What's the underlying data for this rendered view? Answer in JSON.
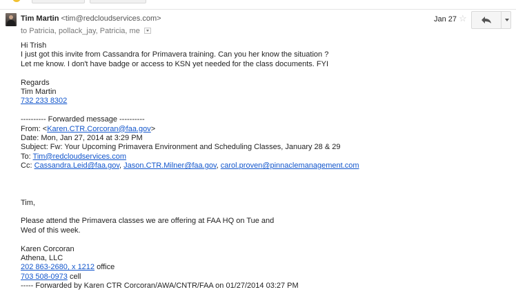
{
  "header": {
    "sender_name": "Tim Martin",
    "sender_email": "<tim@redcloudservices.com>",
    "recipients": "to Patricia, pollack_jay, Patricia, me",
    "date": "Jan 27"
  },
  "icons": {
    "avatar": "avatar-photo",
    "star": "star-icon",
    "reply": "reply-icon",
    "more": "chevron-down-icon",
    "recipients_details": "dropdown-icon"
  },
  "colors": {
    "link": "#1155cc",
    "text": "#222222",
    "muted": "#777777"
  },
  "message": {
    "greeting": "Hi Trish",
    "line1": "I just got this invite from Cassandra for Primavera training. Can you her know the situation ?",
    "line2": "Let me know. I don't have badge or access to KSN yet needed for the class documents. FYI",
    "regards": "Regards",
    "sig_name": "Tim Martin",
    "sig_phone": "732 233 8302"
  },
  "forwarded": {
    "divider": "---------- Forwarded message ----------",
    "from_label": "From: <",
    "from_email": "Karen.CTR.Corcoran@faa.gov",
    "from_end": ">",
    "date_line": "Date: Mon, Jan 27, 2014 at 3:29 PM",
    "subject_line": "Subject: Fw: Your Upcoming Primavera Environment and Scheduling Classes, January 28 & 29",
    "to_label": "To: ",
    "to_email": "Tim@redcloudservices.com",
    "cc_label": "Cc: ",
    "cc1": "Cassandra.Leid@faa.gov",
    "cc_sep1": ", ",
    "cc2": "Jason.CTR.Milner@faa.gov",
    "cc_sep2": ", ",
    "cc3": "carol.proven@pinnaclemanagement.com",
    "salutation": "Tim,",
    "body1": "Please attend the Primavera classes we are offering at FAA HQ on Tue and",
    "body2": "Wed of this week.",
    "sig_name": "Karen Corcoran",
    "sig_company": "Athena, LLC",
    "office_phone": "202 863-2680, x 1212",
    "office_label": " office",
    "cell_phone": "703 508-0973",
    "cell_label": " cell",
    "fwd_line": "----- Forwarded by Karen CTR Corcoran/AWA/CNTR/FAA on 01/27/2014 03:27 PM"
  }
}
